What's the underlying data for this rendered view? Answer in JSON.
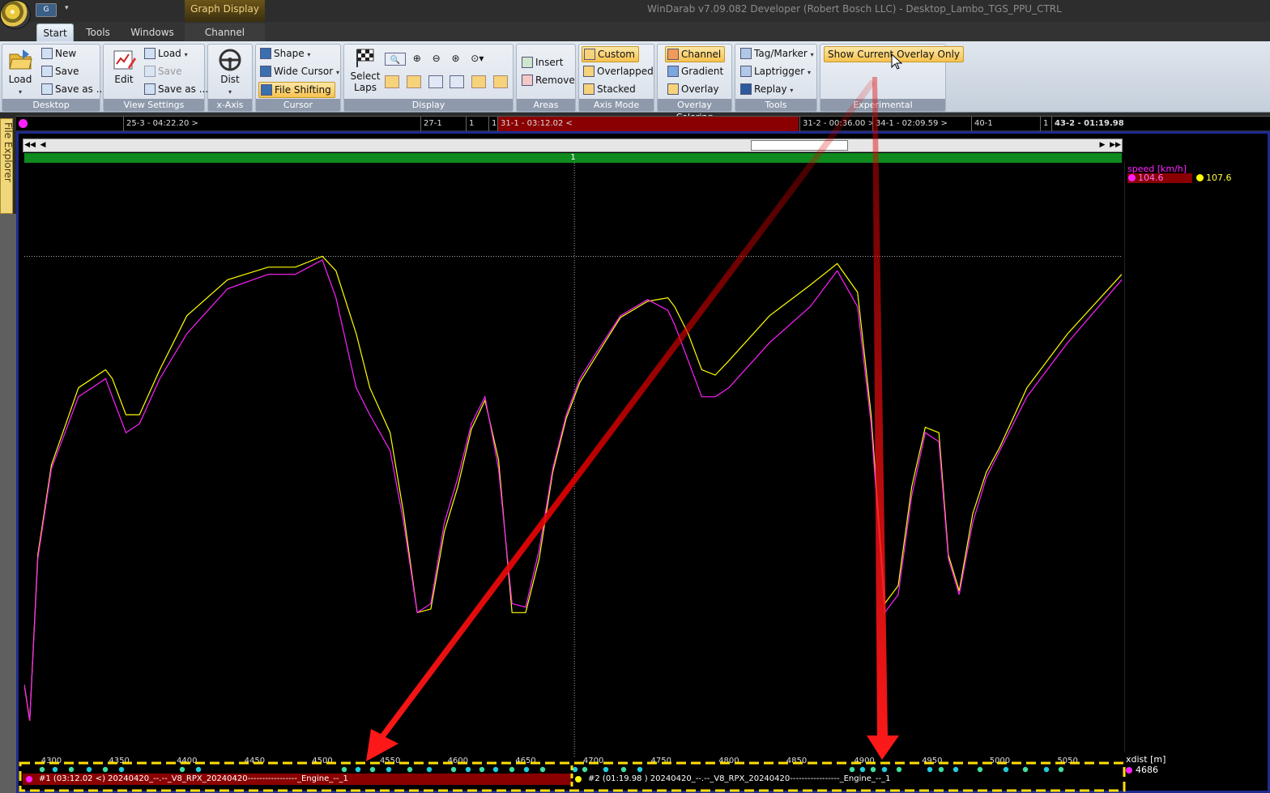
{
  "window": {
    "title": "WinDarab v7.09.082 Developer (Robert Bosch LLC) - Desktop_Lambo_TGS_PPU_CTRL",
    "context_group": "Graph Display"
  },
  "tabs": {
    "start": "Start",
    "tools": "Tools",
    "windows": "Windows",
    "channel": "Channel"
  },
  "ribbon": {
    "desktop": {
      "label": "Desktop",
      "load": "Load",
      "new": "New",
      "save": "Save",
      "save_as": "Save as ..."
    },
    "view_settings": {
      "label": "View Settings",
      "edit": "Edit",
      "load": "Load",
      "save": "Save",
      "save_as": "Save as ..."
    },
    "x_axis": {
      "label": "x-Axis",
      "dist": "Dist"
    },
    "cursor": {
      "label": "Cursor",
      "shape": "Shape",
      "wide_cursor": "Wide Cursor",
      "file_shifting": "File Shifting"
    },
    "display": {
      "label": "Display",
      "select_laps": "Select Laps"
    },
    "areas": {
      "label": "Areas",
      "insert": "Insert",
      "remove": "Remove"
    },
    "axis_mode": {
      "label": "Axis Mode",
      "custom": "Custom",
      "overlapped": "Overlapped",
      "stacked": "Stacked"
    },
    "overlay_coloring": {
      "label": "Overlay Coloring",
      "channel": "Channel",
      "gradient": "Gradient",
      "overlay": "Overlay"
    },
    "tools": {
      "label": "Tools",
      "tag_marker": "Tag/Marker",
      "laptrigger": "Laptrigger",
      "replay": "Replay"
    },
    "experimental": {
      "label": "Experimental",
      "show_current_overlay": "Show Current Overlay Only"
    }
  },
  "status_segments": [
    "25-3 - 04:22.20 >",
    "27-1",
    "1",
    "1",
    "31-1 - 03:12.02 <",
    "31-2 - 00:36.00 >",
    "34-1 - 02:09.59 >",
    "40-1",
    "1",
    "43-2 - 01:19.98"
  ],
  "side_panel": {
    "file_explorer": "File Explorer"
  },
  "lap_bar": {
    "label": "1"
  },
  "legend": {
    "channel": "speed [km/h]",
    "value_1": "104.6",
    "value_2": "107.6",
    "x_axis_name": "xdist [m]",
    "x_axis_value": "4686"
  },
  "files": {
    "file_1": "#1 (03:12.02 <) 20240420_--.--_V8_RPX_20240420-----------------_Engine_--_1",
    "file_2": "#2 (01:19.98 ) 20240420_--.--_V8_RPX_20240420-----------------_Engine_--_1"
  },
  "colors": {
    "series_1": "#ff20ff",
    "series_2": "#ffff00",
    "highlight": "#ffe000",
    "arrow": "#e00000",
    "lap_bar": "#0f8a1f"
  },
  "chart_data": {
    "type": "line",
    "xlabel": "xdist [m]",
    "ylabel": "speed [km/h]",
    "xlim": [
      4280,
      5090
    ],
    "ylim": [
      0,
      330
    ],
    "cursor_x": 4686,
    "x_ticks": [
      4300,
      4350,
      4400,
      4450,
      4500,
      4550,
      4600,
      4650,
      4700,
      4750,
      4800,
      4850,
      4900,
      4950,
      5000,
      5050
    ],
    "series": [
      {
        "name": "#1 (03:12.02 <)",
        "x": [
          4280,
          4284,
          4290,
          4300,
          4320,
          4340,
          4345,
          4355,
          4365,
          4380,
          4400,
          4430,
          4460,
          4480,
          4500,
          4510,
          4525,
          4535,
          4550,
          4560,
          4570,
          4580,
          4590,
          4600,
          4610,
          4620,
          4630,
          4640,
          4650,
          4660,
          4670,
          4680,
          4690,
          4700,
          4720,
          4740,
          4755,
          4760,
          4770,
          4780,
          4790,
          4800,
          4830,
          4860,
          4880,
          4895,
          4905,
          4915,
          4925,
          4935,
          4945,
          4955,
          4962,
          4970,
          4980,
          4990,
          5000,
          5020,
          5050,
          5090
        ],
        "y": [
          40,
          20,
          110,
          160,
          200,
          210,
          200,
          180,
          185,
          210,
          235,
          260,
          268,
          268,
          276,
          255,
          205,
          190,
          170,
          130,
          80,
          85,
          130,
          155,
          185,
          200,
          160,
          85,
          83,
          115,
          160,
          190,
          210,
          222,
          245,
          254,
          248,
          240,
          220,
          200,
          200,
          205,
          230,
          250,
          270,
          250,
          185,
          80,
          90,
          145,
          180,
          175,
          110,
          90,
          130,
          155,
          170,
          200,
          230,
          265
        ]
      },
      {
        "name": "#2 (01:19.98 )",
        "x": [
          4280,
          4284,
          4290,
          4300,
          4320,
          4340,
          4345,
          4355,
          4365,
          4380,
          4400,
          4430,
          4460,
          4480,
          4500,
          4510,
          4525,
          4535,
          4550,
          4560,
          4570,
          4580,
          4590,
          4600,
          4610,
          4620,
          4630,
          4640,
          4650,
          4660,
          4670,
          4680,
          4690,
          4700,
          4720,
          4740,
          4755,
          4760,
          4770,
          4780,
          4790,
          4800,
          4830,
          4860,
          4880,
          4895,
          4905,
          4915,
          4925,
          4935,
          4945,
          4955,
          4962,
          4970,
          4980,
          4990,
          5000,
          5020,
          5050,
          5090
        ],
        "y": [
          40,
          20,
          112,
          162,
          205,
          215,
          210,
          190,
          190,
          215,
          245,
          265,
          272,
          272,
          278,
          270,
          235,
          205,
          180,
          135,
          80,
          82,
          125,
          150,
          182,
          198,
          165,
          80,
          80,
          110,
          158,
          188,
          208,
          220,
          244,
          253,
          255,
          250,
          235,
          215,
          212,
          220,
          245,
          262,
          274,
          258,
          190,
          85,
          95,
          150,
          183,
          180,
          112,
          92,
          135,
          158,
          172,
          205,
          235,
          268
        ]
      }
    ]
  }
}
